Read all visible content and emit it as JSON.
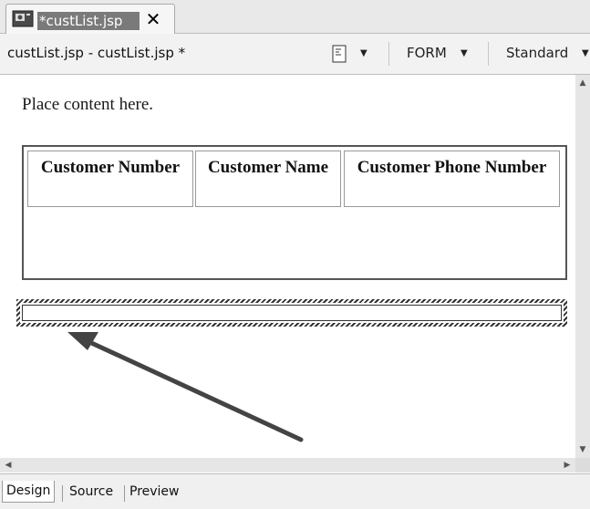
{
  "tab": {
    "label": "*custList.jsp",
    "close_glyph": "✕",
    "icon": "jsp-file-icon"
  },
  "toolbar": {
    "title": "custList.jsp - custList.jsp *",
    "form_label": "FORM",
    "style_label": "Standard",
    "dropdown_glyph": "▼"
  },
  "editor": {
    "placeholder_text": "Place content here.",
    "table": {
      "columns": [
        "Customer Number",
        "Customer Name",
        "Customer Phone Number"
      ]
    }
  },
  "scroll": {
    "up": "▲",
    "down": "▼",
    "left": "◀",
    "right": "▶"
  },
  "views": {
    "design": "Design",
    "source": "Source",
    "preview": "Preview"
  },
  "colors": {
    "tab_label_bg": "#7a7a7a",
    "arrow": "#444444"
  }
}
